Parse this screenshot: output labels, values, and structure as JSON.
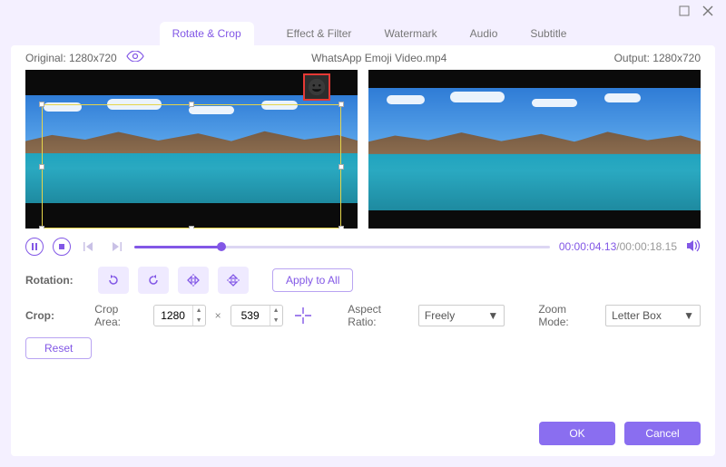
{
  "window": {
    "tabs": [
      "Rotate & Crop",
      "Effect & Filter",
      "Watermark",
      "Audio",
      "Subtitle"
    ],
    "active_tab": 0
  },
  "status": {
    "original_label": "Original: 1280x720",
    "filename": "WhatsApp Emoji Video.mp4",
    "output_label": "Output: 1280x720"
  },
  "playback": {
    "current": "00:00:04.13",
    "separator": "/",
    "duration": "00:00:18.15",
    "progress_percent": 21
  },
  "rotation": {
    "label": "Rotation:",
    "apply_all": "Apply to All"
  },
  "crop": {
    "label": "Crop:",
    "area_label": "Crop Area:",
    "width": "1280",
    "height": "539",
    "times": "×",
    "aspect_label": "Aspect Ratio:",
    "aspect_value": "Freely",
    "zoom_label": "Zoom Mode:",
    "zoom_value": "Letter Box",
    "reset": "Reset"
  },
  "footer": {
    "ok": "OK",
    "cancel": "Cancel"
  }
}
